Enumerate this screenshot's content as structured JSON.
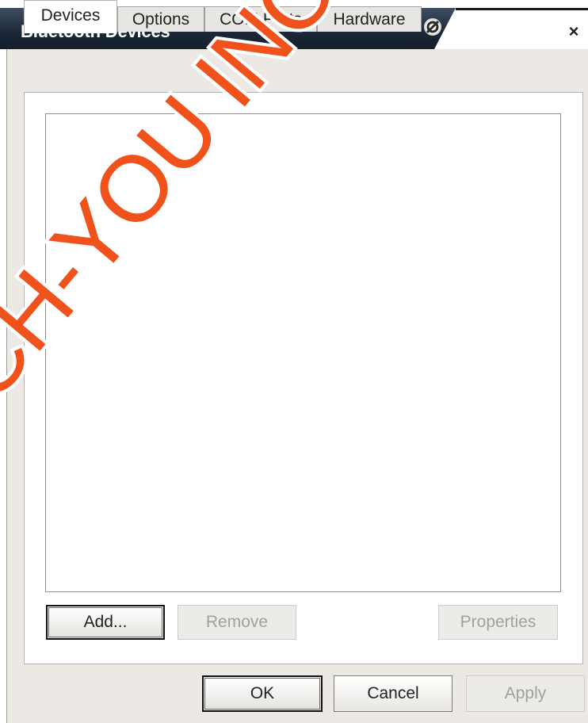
{
  "window": {
    "title": "Bluetooth Devices",
    "close_glyph": "×"
  },
  "tabs": [
    {
      "label": "Devices",
      "active": true
    },
    {
      "label": "Options",
      "active": false
    },
    {
      "label": "COM Ports",
      "active": false
    },
    {
      "label": "Hardware",
      "active": false
    }
  ],
  "devices_panel": {
    "add_label": "Add...",
    "remove_label": "Remove",
    "properties_label": "Properties"
  },
  "footer": {
    "ok_label": "OK",
    "cancel_label": "Cancel",
    "apply_label": "Apply"
  },
  "watermark": "CH-YOU INC.",
  "colors": {
    "titlebar": "#1c2838",
    "window_bg": "#ece9e5",
    "watermark": "#f1511a"
  },
  "icons": {
    "title_icon": "pin-icon"
  }
}
